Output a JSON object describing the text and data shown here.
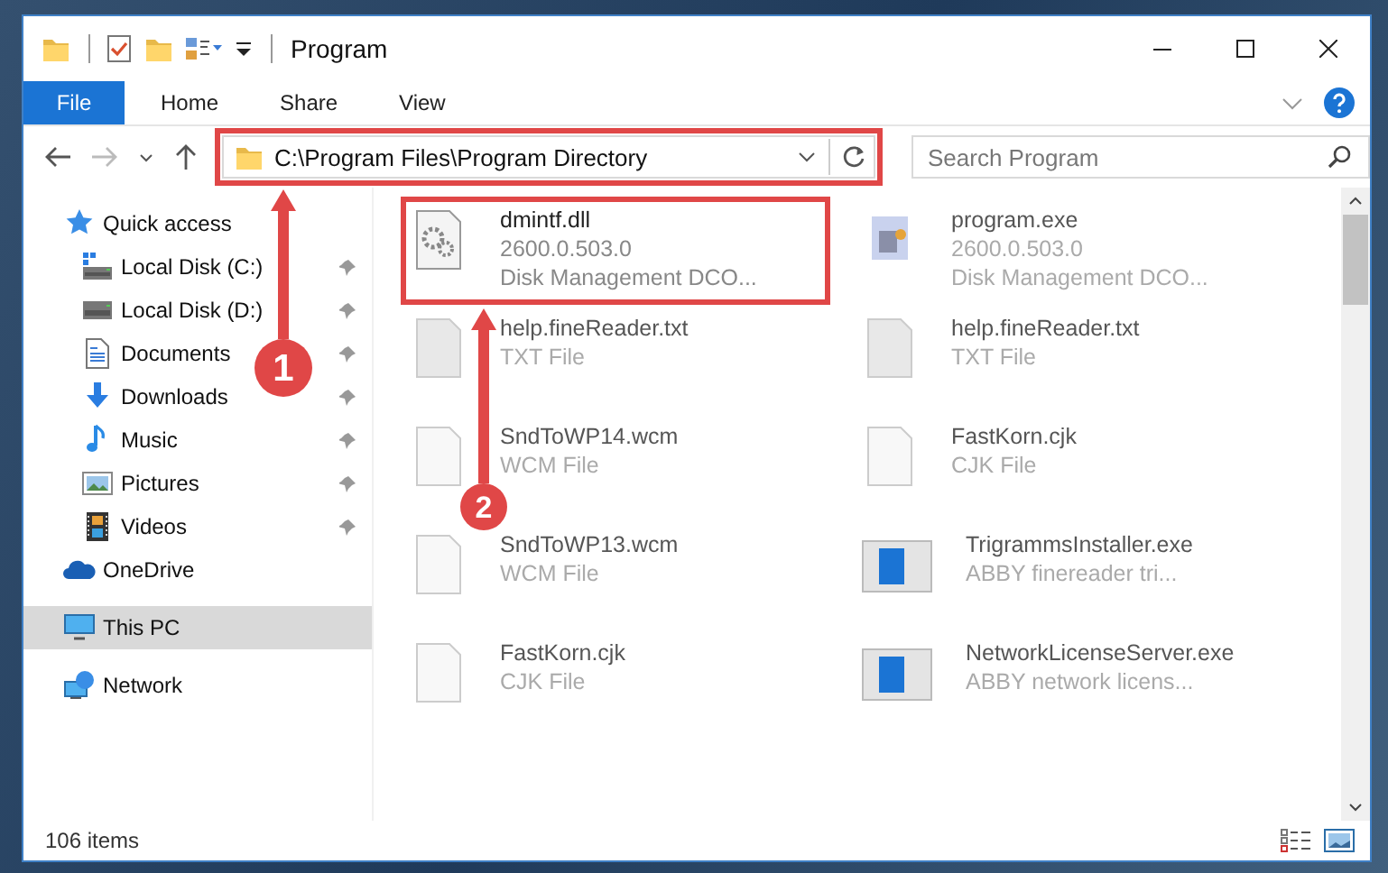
{
  "window": {
    "title": "Program"
  },
  "ribbon": {
    "tabs": [
      {
        "label": "File",
        "selected": true
      },
      {
        "label": "Home",
        "selected": false
      },
      {
        "label": "Share",
        "selected": false
      },
      {
        "label": "View",
        "selected": false
      }
    ]
  },
  "address_bar": {
    "path": "C:\\Program Files\\Program Directory",
    "highlighted": true
  },
  "search": {
    "placeholder": "Search Program"
  },
  "sidebar": {
    "items": [
      {
        "label": "Quick access",
        "kind": "star",
        "pinned": false,
        "selected": false,
        "children": [
          {
            "label": "Local Disk (C:)",
            "kind": "system-drive",
            "pinned": true,
            "selected": false
          },
          {
            "label": "Local Disk (D:)",
            "kind": "drive",
            "pinned": true,
            "selected": false
          },
          {
            "label": "Documents",
            "kind": "documents",
            "pinned": true,
            "selected": false
          },
          {
            "label": "Downloads",
            "kind": "downloads",
            "pinned": true,
            "selected": false
          },
          {
            "label": "Music",
            "kind": "music",
            "pinned": true,
            "selected": false
          },
          {
            "label": "Pictures",
            "kind": "pictures",
            "pinned": true,
            "selected": false
          },
          {
            "label": "Videos",
            "kind": "videos",
            "pinned": true,
            "selected": false
          }
        ]
      },
      {
        "label": "OneDrive",
        "kind": "cloud",
        "pinned": false,
        "selected": false
      },
      {
        "label": "This PC",
        "kind": "pc",
        "pinned": false,
        "selected": true
      },
      {
        "label": "Network",
        "kind": "network",
        "pinned": false,
        "selected": false
      }
    ]
  },
  "files": [
    {
      "name": "dmintf.dll",
      "kind": "dll",
      "details": [
        "2600.0.503.0",
        "Disk Management DCO..."
      ],
      "highlighted": true
    },
    {
      "name": "program.exe",
      "kind": "app",
      "details": [
        "2600.0.503.0",
        "Disk Management DCO..."
      ],
      "highlighted": false
    },
    {
      "name": "help.fineReader.txt",
      "kind": "txt",
      "details": [
        "TXT File"
      ],
      "highlighted": false
    },
    {
      "name": "help.fineReader.txt",
      "kind": "txt",
      "details": [
        "TXT File"
      ],
      "highlighted": false
    },
    {
      "name": "SndToWP14.wcm",
      "kind": "blank",
      "details": [
        "WCM File"
      ],
      "highlighted": false
    },
    {
      "name": "FastKorn.cjk",
      "kind": "blank",
      "details": [
        "CJK File"
      ],
      "highlighted": false
    },
    {
      "name": "SndToWP13.wcm",
      "kind": "blank",
      "details": [
        "WCM File"
      ],
      "highlighted": false
    },
    {
      "name": "TrigrammsInstaller.exe",
      "kind": "installer",
      "details": [
        "ABBY finereader tri..."
      ],
      "highlighted": false
    },
    {
      "name": "FastKorn.cjk",
      "kind": "blank",
      "details": [
        "CJK File"
      ],
      "highlighted": false
    },
    {
      "name": "NetworkLicenseServer.exe",
      "kind": "installer",
      "details": [
        "ABBY network licens..."
      ],
      "highlighted": false
    }
  ],
  "status_bar": {
    "count": "106 items"
  },
  "annotations": [
    {
      "label": "1"
    },
    {
      "label": "2"
    }
  ]
}
